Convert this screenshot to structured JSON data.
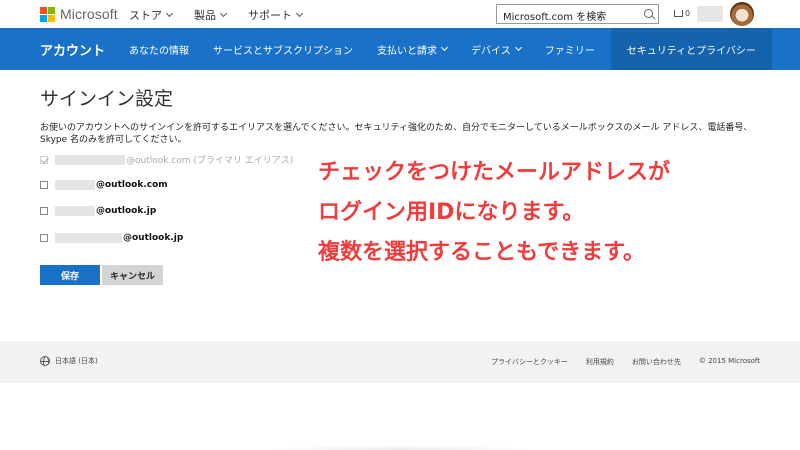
{
  "brand": {
    "name": "Microsoft",
    "logo_colors": [
      "#f25022",
      "#7fba00",
      "#00a4ef",
      "#ffb900"
    ]
  },
  "top_nav": {
    "items": [
      {
        "label": "ストア",
        "icon": "chevron-down-icon"
      },
      {
        "label": "製品",
        "icon": "chevron-down-icon"
      },
      {
        "label": "サポート",
        "icon": "chevron-down-icon"
      }
    ],
    "search": {
      "value": "Microsoft.com を検索",
      "icon": "search-icon"
    },
    "cart": {
      "count": "0",
      "icon": "cart-icon"
    }
  },
  "account_nav": {
    "brand": "アカウント",
    "items": [
      {
        "label": "あなたの情報"
      },
      {
        "label": "サービスとサブスクリプション"
      },
      {
        "label": "支払いと請求",
        "icon": "chevron-down-icon"
      },
      {
        "label": "デバイス",
        "icon": "chevron-down-icon"
      },
      {
        "label": "ファミリー"
      },
      {
        "label": "セキュリティとプライバシー",
        "active": true
      }
    ],
    "color": "#1a72c8"
  },
  "main": {
    "title": "サインイン設定",
    "description": "お使いのアカウントへのサインインを許可するエイリアスを選んでください。セキュリティ強化のため、自分でモニターしているメールボックスのメール アドレス、電話番号、Skype 名のみを許可してください。",
    "options": [
      {
        "label": "@outlook.com (プライマリ エイリアス)",
        "checked": true,
        "disabled": true
      },
      {
        "label": "@outlook.com",
        "checked": false
      },
      {
        "label": "@outlook.jp",
        "checked": false
      },
      {
        "label": "@outlook.jp",
        "checked": false
      }
    ],
    "save_label": "保存",
    "cancel_label": "キャンセル"
  },
  "overlay": {
    "line1": "チェックをつけたメールアドレスが",
    "line2": "ログイン用IDになります。",
    "line3": "複数を選択することもできます。",
    "color": "#f03c3c"
  },
  "footer": {
    "language": "日本語 (日本)",
    "links": [
      "プライバシーとクッキー",
      "利用規約",
      "お問い合わせ先",
      "© 2015 Microsoft"
    ]
  }
}
